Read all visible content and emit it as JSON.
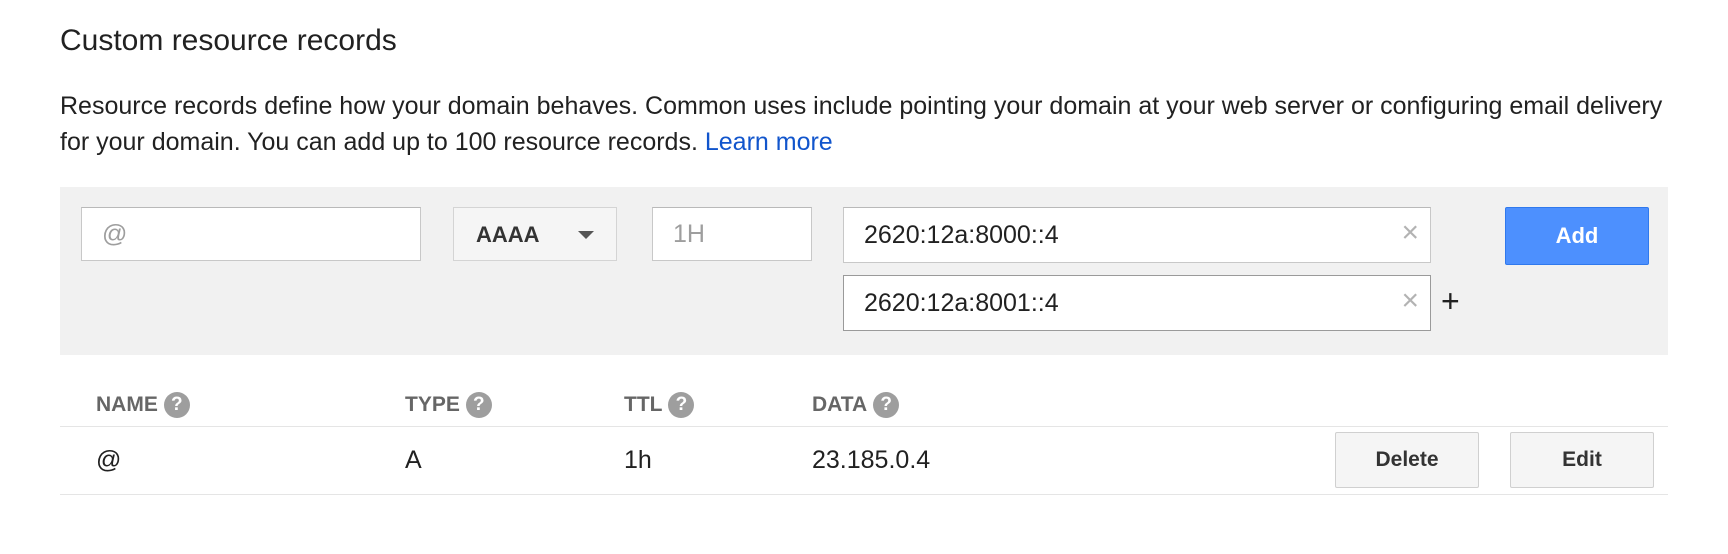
{
  "section": {
    "title": "Custom resource records",
    "description": "Resource records define how your domain behaves. Common uses include pointing your domain at your web server or configuring email delivery for your domain. You can add up to 100 resource records.",
    "learn_more": "Learn more"
  },
  "form": {
    "name_placeholder": "@",
    "type_value": "AAAA",
    "ttl_placeholder": "1H",
    "data_values": [
      "2620:12a:8000::4",
      "2620:12a:8001::4"
    ],
    "clear_glyph": "×",
    "add_more_glyph": "+",
    "add_label": "Add"
  },
  "table": {
    "headers": [
      "NAME",
      "TYPE",
      "TTL",
      "DATA"
    ],
    "help_glyph": "?",
    "rows": [
      {
        "name": "@",
        "type": "A",
        "ttl": "1h",
        "data": "23.185.0.4"
      }
    ],
    "delete_label": "Delete",
    "edit_label": "Edit"
  },
  "colors": {
    "accent": "#4d90fe",
    "link": "#1155cc",
    "panel_bg": "#f1f1f1"
  }
}
